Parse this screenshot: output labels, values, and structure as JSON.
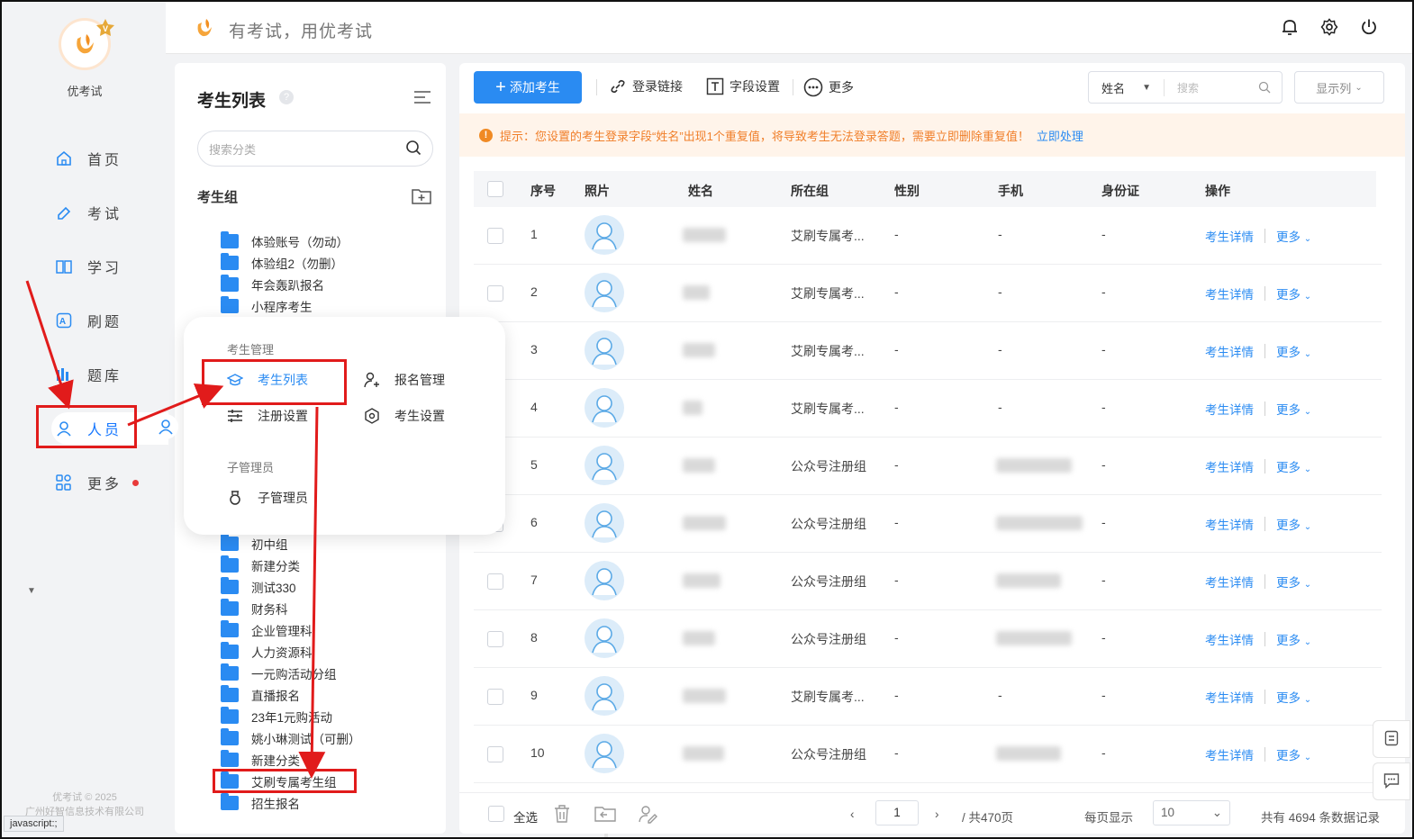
{
  "app": {
    "name": "优考试",
    "slogan": "有考试，用优考试",
    "copyright_line1": "优考试 © 2025",
    "copyright_line2": "广州好智信息技术有限公司"
  },
  "nav": [
    {
      "label": "首页",
      "icon": "home-icon"
    },
    {
      "label": "考试",
      "icon": "exam-icon"
    },
    {
      "label": "学习",
      "icon": "book-icon"
    },
    {
      "label": "刷题",
      "icon": "practice-icon"
    },
    {
      "label": "题库",
      "icon": "question-bank-icon"
    },
    {
      "label": "人员",
      "icon": "user-icon"
    },
    {
      "label": "更多",
      "icon": "apps-icon"
    }
  ],
  "status_bar": "javascript:;",
  "category": {
    "title": "考生列表",
    "help": "?",
    "search_placeholder": "搜索分类",
    "group_header": "考生组",
    "items_top": [
      "体验账号（勿动）",
      "体验组2（勿删）",
      "年会轰趴报名",
      "小程序考生"
    ],
    "items_bottom": [
      "初中组",
      "新建分类",
      "测试330",
      "财务科",
      "企业管理科",
      "人力资源科",
      "一元购活动分组",
      "直播报名",
      "23年1元购活动",
      "姚小琳测试（可删）",
      "新建分类",
      "艾刷专属考生组",
      "招生报名"
    ]
  },
  "popup": {
    "section1": "考生管理",
    "section2": "子管理员",
    "items": {
      "student_list": "考生列表",
      "signup_manage": "报名管理",
      "register_settings": "注册设置",
      "student_settings": "考生设置",
      "sub_admin": "子管理员"
    }
  },
  "toolbar": {
    "add": "添加考生",
    "login_link": "登录链接",
    "field_settings": "字段设置",
    "more": "更多",
    "filter_field": "姓名",
    "search_placeholder": "搜索",
    "columns": "显示列"
  },
  "notice": {
    "text": "提示：您设置的考生登录字段“姓名”出现1个重复值，将导致考生无法登录答题，需要立即删除重复值！",
    "link": "立即处理"
  },
  "table": {
    "headers": [
      "序号",
      "照片",
      "姓名",
      "所在组",
      "性别",
      "手机",
      "身份证",
      "操作"
    ],
    "rows": [
      {
        "no": "1",
        "group": "艾刷专属考...",
        "gender": "-",
        "phone": "-",
        "id": "-"
      },
      {
        "no": "2",
        "group": "艾刷专属考...",
        "gender": "-",
        "phone": "-",
        "id": "-"
      },
      {
        "no": "3",
        "group": "艾刷专属考...",
        "gender": "-",
        "phone": "-",
        "id": "-"
      },
      {
        "no": "4",
        "group": "艾刷专属考...",
        "gender": "-",
        "phone": "-",
        "id": "-"
      },
      {
        "no": "5",
        "group": "公众号注册组",
        "gender": "-",
        "phone": "",
        "id": "-"
      },
      {
        "no": "6",
        "group": "公众号注册组",
        "gender": "-",
        "phone": "",
        "id": "-"
      },
      {
        "no": "7",
        "group": "公众号注册组",
        "gender": "-",
        "phone": "",
        "id": "-"
      },
      {
        "no": "8",
        "group": "公众号注册组",
        "gender": "-",
        "phone": "",
        "id": "-"
      },
      {
        "no": "9",
        "group": "艾刷专属考...",
        "gender": "-",
        "phone": "-",
        "id": "-"
      },
      {
        "no": "10",
        "group": "公众号注册组",
        "gender": "-",
        "phone": "",
        "id": "-"
      }
    ],
    "op_detail": "考生详情",
    "op_more": "更多"
  },
  "pager": {
    "select_all": "全选",
    "current_page": "1",
    "total_pages": "/ 共470页",
    "page_size_label": "每页显示",
    "page_size": "10",
    "total": "共有 4694 条数据记录"
  },
  "colors": {
    "primary": "#2a8bf2",
    "warning": "#f07f2a",
    "annotation": "#e11b1b"
  }
}
